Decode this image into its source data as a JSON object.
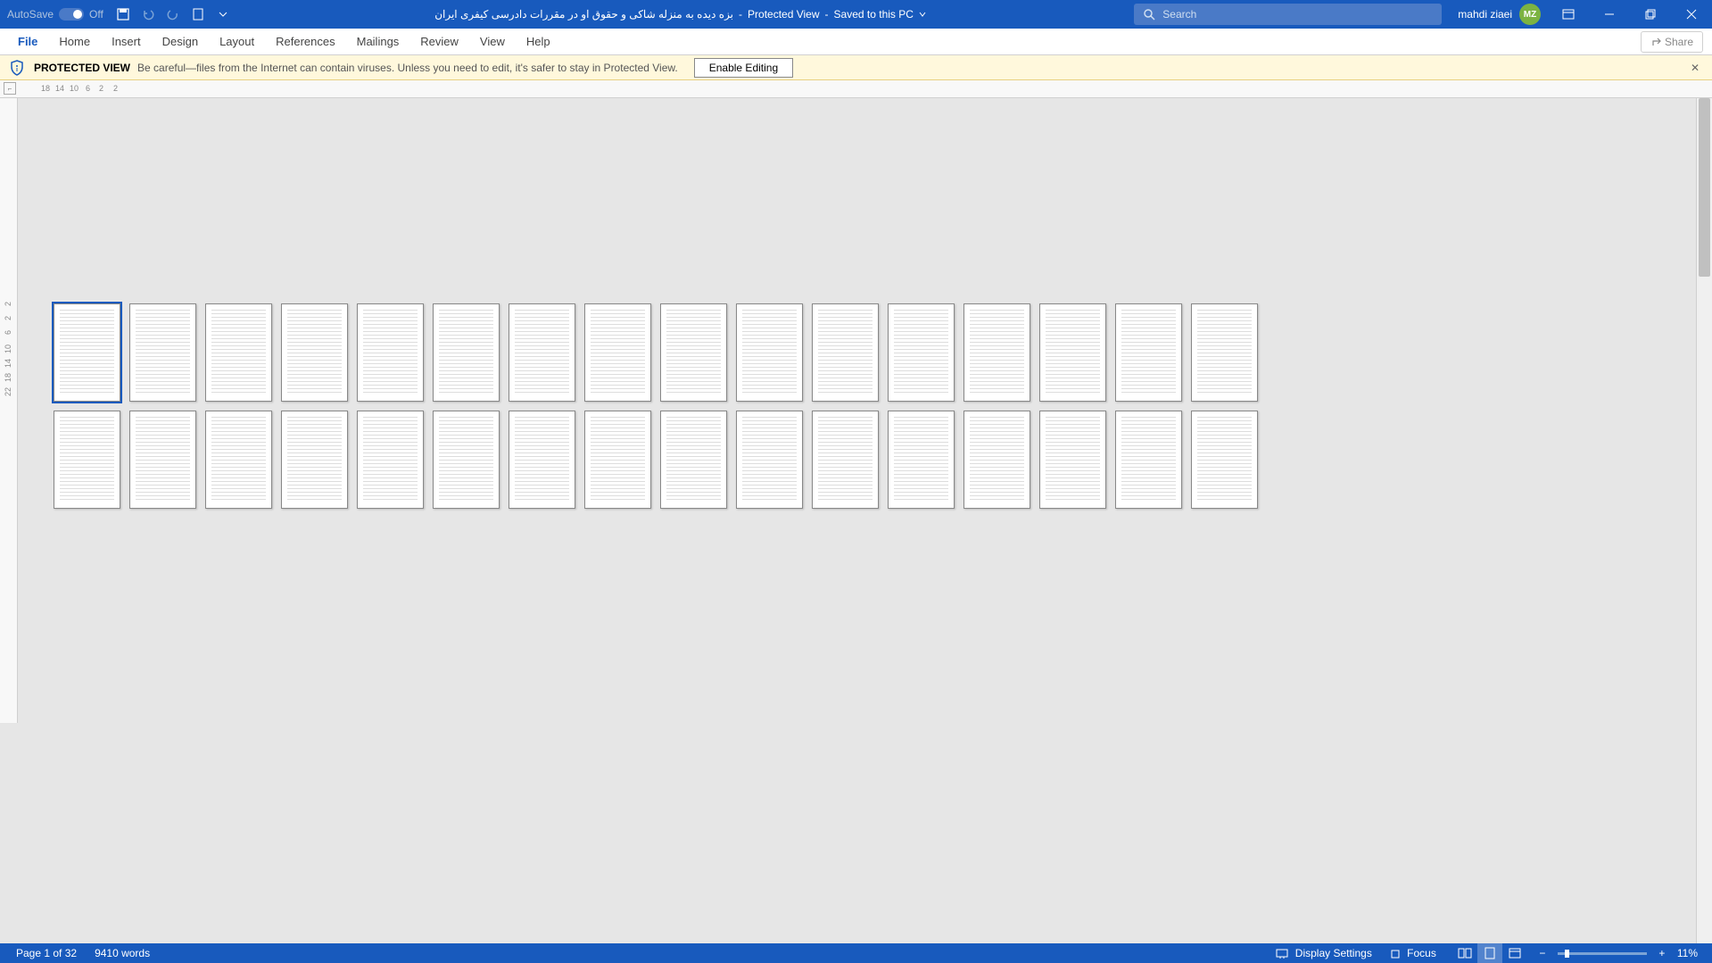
{
  "title_bar": {
    "autosave_label": "AutoSave",
    "autosave_state": "Off",
    "doc_name": "بزه دیده به منزله شاکی و حقوق او در مقررات دادرسی کیفری ایران",
    "protected_label": "Protected View",
    "saved_label": "Saved to this PC",
    "user_name": "mahdi ziaei",
    "user_initials": "MZ",
    "search_placeholder": "Search"
  },
  "ribbon": {
    "tabs": [
      "File",
      "Home",
      "Insert",
      "Design",
      "Layout",
      "References",
      "Mailings",
      "Review",
      "View",
      "Help"
    ],
    "share_label": "Share"
  },
  "protected_bar": {
    "title": "PROTECTED VIEW",
    "message": "Be careful—files from the Internet can contain viruses. Unless you need to edit, it's safer to stay in Protected View.",
    "enable_label": "Enable Editing"
  },
  "ruler": {
    "horiz_marks": [
      "18",
      "14",
      "10",
      "6",
      "2",
      "2"
    ],
    "vert_marks": [
      "2",
      "2",
      "6",
      "10",
      "14",
      "18",
      "22"
    ]
  },
  "document": {
    "total_pages": 32
  },
  "status_bar": {
    "page_info": "Page 1 of 32",
    "word_count": "9410 words",
    "display_settings": "Display Settings",
    "focus": "Focus",
    "zoom_pct": "11%"
  }
}
